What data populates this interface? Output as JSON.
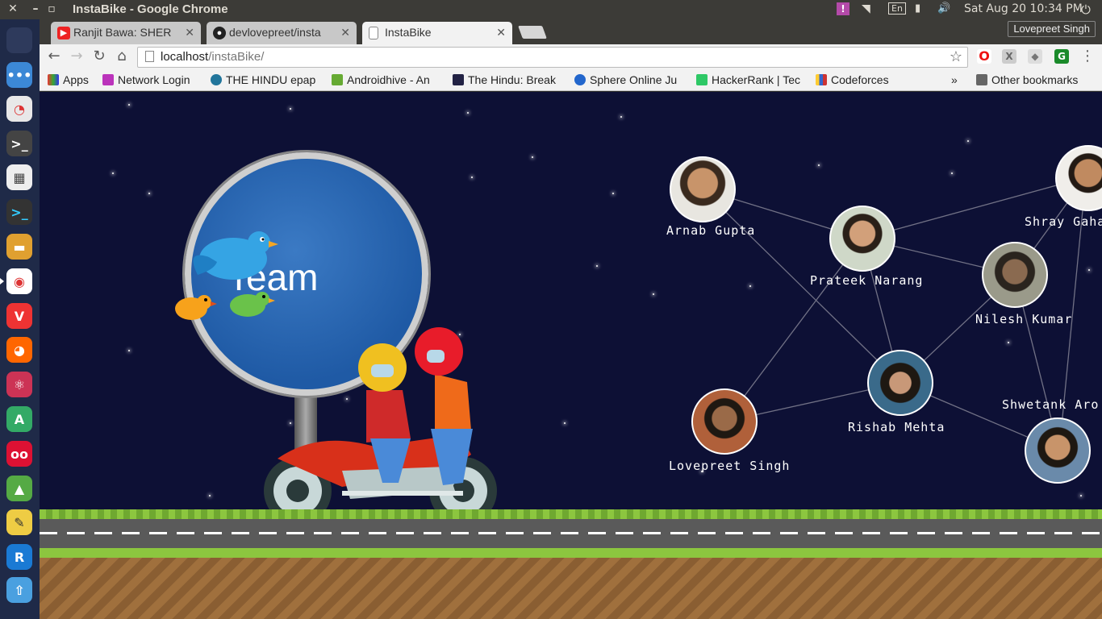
{
  "system_bar": {
    "window_title": "InstaBike - Google Chrome",
    "datetime": "Sat Aug 20 10:34 PM",
    "keyboard_layout": "En",
    "user": "Lovepreet Singh"
  },
  "tabs": [
    {
      "label": "Ranjit Bawa: SHER",
      "icon": "youtube-icon",
      "active": false
    },
    {
      "label": "devlovepreet/insta",
      "icon": "github-icon",
      "active": false
    },
    {
      "label": "InstaBike",
      "icon": "page-icon",
      "active": true
    }
  ],
  "address_bar": {
    "host": "localhost",
    "path": "/instaBike/"
  },
  "bookmarks": [
    {
      "label": "Apps",
      "icon": "apps-icon"
    },
    {
      "label": "Network Login",
      "icon": "umbrella-icon"
    },
    {
      "label": "THE HINDU epap",
      "icon": "wordpress-icon"
    },
    {
      "label": "Androidhive - An",
      "icon": "androidhive-icon"
    },
    {
      "label": "The Hindu: Break",
      "icon": "thehindu-icon"
    },
    {
      "label": "Sphere Online Ju",
      "icon": "spoj-icon"
    },
    {
      "label": "HackerRank | Tec",
      "icon": "hackerrank-icon"
    },
    {
      "label": "Codeforces",
      "icon": "codeforces-icon"
    }
  ],
  "other_bookmarks": "Other bookmarks",
  "more_bookmarks": "»",
  "page": {
    "sign_text": "Team",
    "members": [
      {
        "name": "Arnab Gupta"
      },
      {
        "name": "Prateek Narang"
      },
      {
        "name": "Shray Gaha"
      },
      {
        "name": "Nilesh Kumar"
      },
      {
        "name": "Rishab Mehta"
      },
      {
        "name": "Lovepreet Singh"
      },
      {
        "name": "Shwetank Aro"
      },
      {
        "name": ""
      }
    ]
  },
  "colors": {
    "sky": "#0d1035",
    "launcher": "#1f2a48",
    "grass": "#8cc63f",
    "road": "#5a5a5a"
  }
}
